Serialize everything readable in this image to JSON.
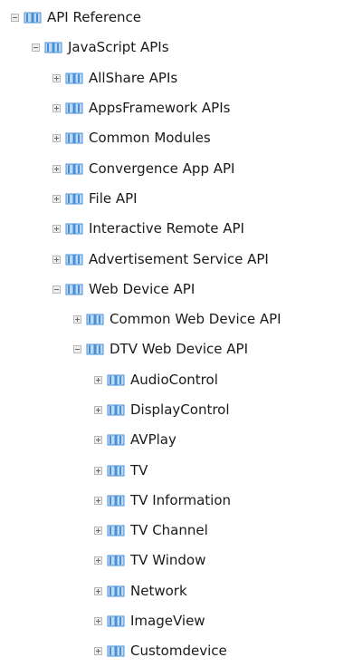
{
  "tree": {
    "items": [
      {
        "label": "API Reference",
        "level": 0,
        "expanded": true,
        "name": "tree-item-api-reference"
      },
      {
        "label": "JavaScript APIs",
        "level": 1,
        "expanded": true,
        "name": "tree-item-javascript-apis"
      },
      {
        "label": "AllShare APIs",
        "level": 2,
        "expanded": false,
        "name": "tree-item-allshare-apis"
      },
      {
        "label": "AppsFramework APIs",
        "level": 2,
        "expanded": false,
        "name": "tree-item-appsframework-apis"
      },
      {
        "label": "Common Modules",
        "level": 2,
        "expanded": false,
        "name": "tree-item-common-modules"
      },
      {
        "label": "Convergence App API",
        "level": 2,
        "expanded": false,
        "name": "tree-item-convergence-app-api"
      },
      {
        "label": "File API",
        "level": 2,
        "expanded": false,
        "name": "tree-item-file-api"
      },
      {
        "label": "Interactive Remote API",
        "level": 2,
        "expanded": false,
        "name": "tree-item-interactive-remote-api"
      },
      {
        "label": "Advertisement Service API",
        "level": 2,
        "expanded": false,
        "name": "tree-item-advertisement-service-api"
      },
      {
        "label": "Web Device API",
        "level": 2,
        "expanded": true,
        "name": "tree-item-web-device-api"
      },
      {
        "label": "Common Web Device API",
        "level": 3,
        "expanded": false,
        "name": "tree-item-common-web-device-api"
      },
      {
        "label": "DTV Web Device API",
        "level": 3,
        "expanded": true,
        "name": "tree-item-dtv-web-device-api"
      },
      {
        "label": "AudioControl",
        "level": 4,
        "expanded": false,
        "name": "tree-item-audiocontrol"
      },
      {
        "label": "DisplayControl",
        "level": 4,
        "expanded": false,
        "name": "tree-item-displaycontrol"
      },
      {
        "label": "AVPlay",
        "level": 4,
        "expanded": false,
        "name": "tree-item-avplay"
      },
      {
        "label": "TV",
        "level": 4,
        "expanded": false,
        "name": "tree-item-tv"
      },
      {
        "label": "TV Information",
        "level": 4,
        "expanded": false,
        "name": "tree-item-tv-information"
      },
      {
        "label": "TV Channel",
        "level": 4,
        "expanded": false,
        "name": "tree-item-tv-channel"
      },
      {
        "label": "TV Window",
        "level": 4,
        "expanded": false,
        "name": "tree-item-tv-window"
      },
      {
        "label": "Network",
        "level": 4,
        "expanded": false,
        "name": "tree-item-network"
      },
      {
        "label": "ImageView",
        "level": 4,
        "expanded": false,
        "name": "tree-item-imageview"
      },
      {
        "label": "Customdevice",
        "level": 4,
        "expanded": false,
        "name": "tree-item-customdevice"
      }
    ]
  },
  "icons": {
    "expanded": "minus-toggle-icon",
    "collapsed": "plus-toggle-icon",
    "node": "book-icon"
  },
  "colors": {
    "book_blue": "#4a8fd6",
    "book_light": "#bcd9f5",
    "toggle_border": "#b8b8b8",
    "text": "#1a1a1a"
  }
}
